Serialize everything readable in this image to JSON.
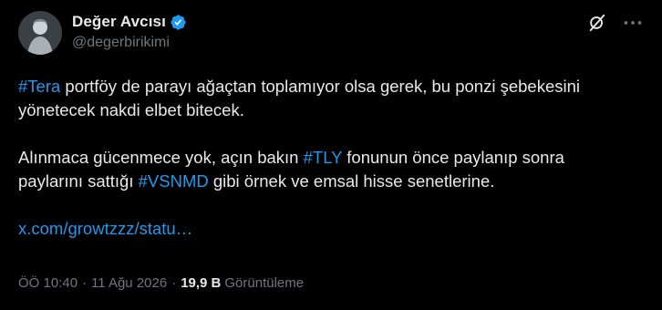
{
  "author": {
    "display_name": "Değer Avcısı",
    "handle": "@degerbirikimi",
    "verified": true
  },
  "body": {
    "line1_hashtag": "#Tera",
    "line1_text": " portföy de parayı ağaçtan toplamıyor olsa gerek, bu ponzi şebekesini yönetecek nakdi elbet bitecek.",
    "line2_text_a": "Alınmaca gücenmece yok, açın bakın ",
    "line2_hashtag_a": "#TLY",
    "line2_text_b": " fonunun önce paylanıp sonra paylarını sattığı ",
    "line2_hashtag_b": "#VSNMD",
    "line2_text_c": " gibi örnek ve emsal hisse senetlerine.",
    "link": "x.com/growtzzz/statu…"
  },
  "meta": {
    "time": "ÖÖ 10:40",
    "separator": "·",
    "date": "11 Ağu 2026",
    "views_count": "19,9 B",
    "views_label": "Görüntüleme"
  },
  "icons": {
    "grok": "grok-icon",
    "more": "more-icon",
    "verified": "verified-badge-icon"
  },
  "colors": {
    "background": "#000000",
    "text": "#e7e9ea",
    "secondary": "#71767b",
    "accent": "#1d9bf0"
  }
}
